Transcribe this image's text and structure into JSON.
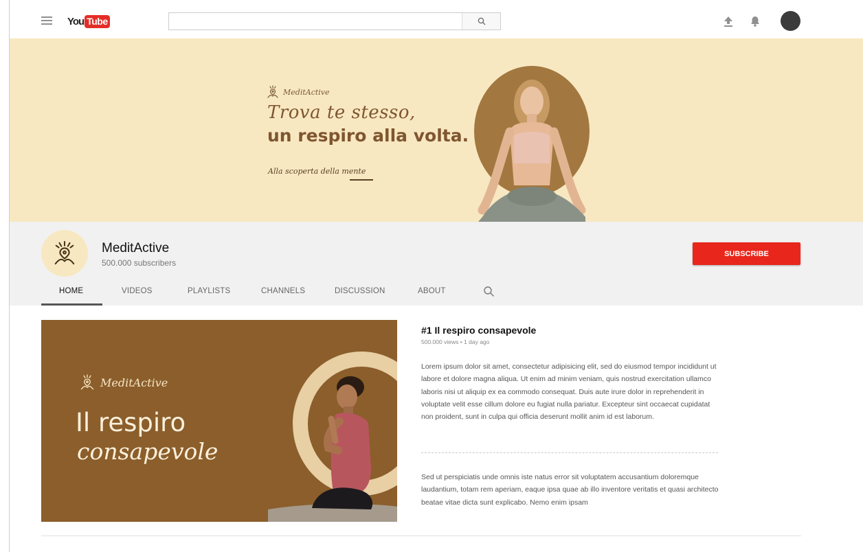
{
  "topbar": {
    "logo_you": "You",
    "logo_tube": "Tube",
    "search_placeholder": "",
    "search_value": ""
  },
  "banner": {
    "brand": "MeditActive",
    "headline_1": "Trova te stesso,",
    "headline_2": "un respiro alla volta.",
    "tagline": "Alla scoperta della mente",
    "background_color": "#f8e8c2",
    "accent_color": "#a27840"
  },
  "channel": {
    "name": "MeditActive",
    "subscribers": "500.000 subscribers",
    "subscribe_label": "SUBSCRIBE",
    "subscribe_color": "#e8261b",
    "tabs": [
      {
        "label": "HOME",
        "active": true
      },
      {
        "label": "VIDEOS",
        "active": false
      },
      {
        "label": "PLAYLISTS",
        "active": false
      },
      {
        "label": "CHANNELS",
        "active": false
      },
      {
        "label": "DISCUSSION",
        "active": false
      },
      {
        "label": "ABOUT",
        "active": false
      }
    ]
  },
  "featured_video": {
    "thumb_brand": "MeditActive",
    "thumb_title_1": "Il respiro",
    "thumb_title_2": "consapevole",
    "title": "#1 Il respiro consapevole",
    "meta": "500.000 views • 1 day ago",
    "description_1": "Lorem ipsum dolor sit amet, consectetur adipisicing elit, sed do eiusmod tempor incididunt ut labore et dolore magna aliqua. Ut enim ad minim veniam, quis nostrud exercitation ullamco laboris nisi ut aliquip ex ea commodo consequat. Duis aute irure dolor in reprehenderit in voluptate velit esse cillum dolore eu fugiat nulla pariatur. Excepteur sint occaecat cupidatat non proident, sunt in culpa qui officia deserunt mollit anim id est laborum.",
    "description_2": "Sed ut perspiciatis unde omnis iste natus error sit voluptatem accusantium doloremque laudantium, totam rem aperiam, eaque ipsa quae ab illo inventore veritatis et quasi architecto beatae vitae dicta sunt explicabo. Nemo enim ipsam",
    "thumb_color": "#8b5e2b"
  }
}
